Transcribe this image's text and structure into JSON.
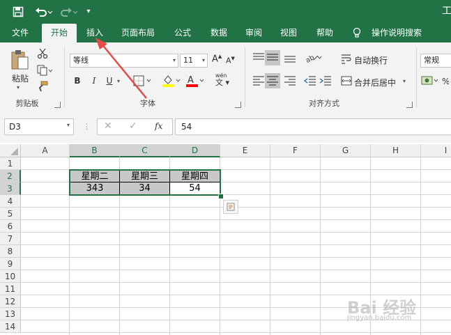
{
  "colors": {
    "brand": "#217346",
    "ribbon_bg": "#f3f3f3",
    "selection_gray": "#c8c8c8",
    "arrow": "#e84a4a",
    "font_red": "#ff0000",
    "fill_yellow": "#ffff00"
  },
  "title_bar": {
    "right_text": "工",
    "icons": [
      "save-icon",
      "undo-icon",
      "redo-icon",
      "customize-qat-icon"
    ]
  },
  "tabs": [
    "文件",
    "开始",
    "插入",
    "页面布局",
    "公式",
    "数据",
    "审阅",
    "视图",
    "帮助"
  ],
  "active_tab": "开始",
  "tell_me": "操作说明搜索",
  "ribbon": {
    "clipboard": {
      "paste": "粘贴",
      "label": "剪贴板"
    },
    "font": {
      "name": "等线",
      "size": "11",
      "bold": "B",
      "italic": "I",
      "underline": "U",
      "label": "字体",
      "wen": "wén"
    },
    "alignment": {
      "wrap": "自动换行",
      "merge": "合并后居中",
      "label": "对齐方式"
    },
    "number": {
      "format": "常规"
    }
  },
  "formula_bar": {
    "name_box": "D3",
    "fx": "fx",
    "value": "54"
  },
  "columns": [
    "A",
    "B",
    "C",
    "D",
    "E",
    "F",
    "G",
    "H",
    "I"
  ],
  "rows": [
    "1",
    "2",
    "3",
    "4",
    "5",
    "6",
    "7",
    "8",
    "9",
    "10",
    "11",
    "12",
    "13",
    "14"
  ],
  "table": {
    "headers": [
      "星期二",
      "星期三",
      "星期四"
    ],
    "values": [
      "343",
      "34",
      "54"
    ]
  },
  "watermark": {
    "line1": "Bai 经验",
    "line2": "jingyan.baidu.com"
  }
}
